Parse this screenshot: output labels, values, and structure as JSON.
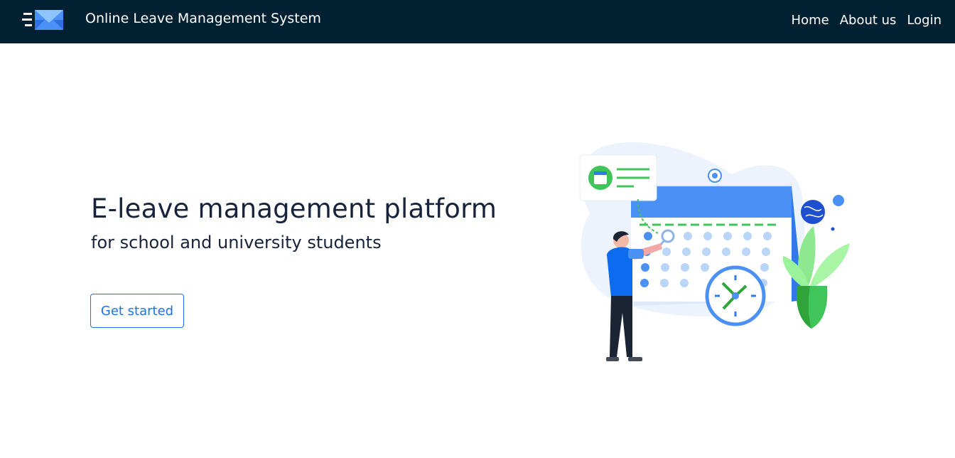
{
  "navbar": {
    "logo_icon": "envelope-logo-icon",
    "brand_name": "Online Leave Management System",
    "links": [
      {
        "label": "Home"
      },
      {
        "label": "About us"
      },
      {
        "label": "Login"
      }
    ]
  },
  "hero": {
    "title": "E-leave management platform",
    "subtitle": "for school and university students",
    "cta_label": "Get started",
    "illustration": "calendar-scheduling-illustration"
  },
  "colors": {
    "navbar_bg": "#012133",
    "accent": "#1a73e8",
    "heading": "#17233a",
    "illustration_blue": "#4a90f5",
    "illustration_green": "#3fc55a"
  }
}
